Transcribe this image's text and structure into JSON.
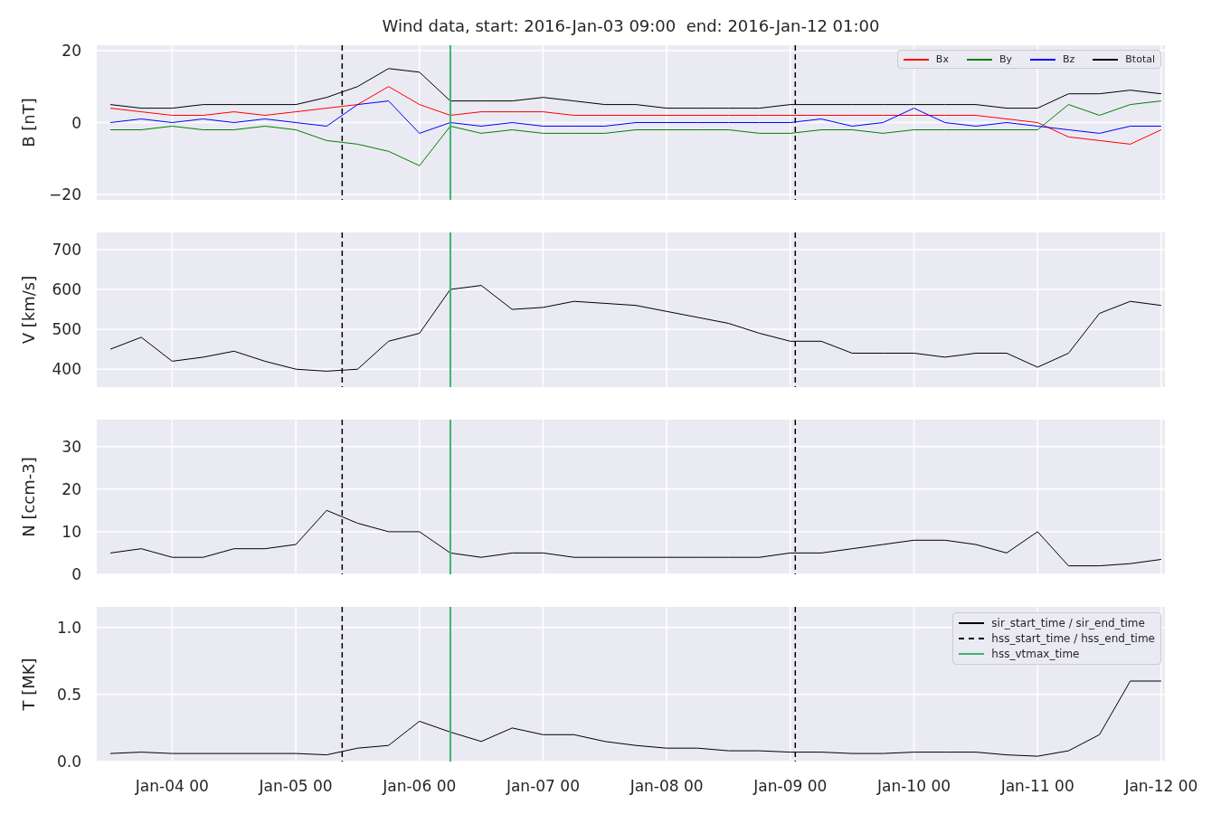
{
  "figure": {
    "title": "Wind data, start: 2016-Jan-03 09:00  end: 2016-Jan-12 01:00"
  },
  "panels": [
    {
      "chart_data": {
        "type": "line",
        "grid": true,
        "ylabel": "B [nT]",
        "ylim": [
          -21.5,
          21.5
        ],
        "yticks": [
          {
            "value": 20,
            "label": "20"
          },
          {
            "value": 0,
            "label": "0"
          },
          {
            "value": -20,
            "label": "−20"
          }
        ],
        "series": [
          {
            "name": "Bx",
            "color": "#ff0000",
            "values": [
              4,
              3,
              2,
              2,
              3,
              2,
              3,
              4,
              5,
              10,
              5,
              2,
              3,
              3,
              3,
              2,
              2,
              2,
              2,
              2,
              2,
              2,
              2,
              2,
              2,
              2,
              2,
              2,
              2,
              1,
              0,
              -4,
              -5,
              -6,
              -2
            ]
          },
          {
            "name": "By",
            "color": "#008000",
            "values": [
              -2,
              -2,
              -1,
              -2,
              -2,
              -1,
              -2,
              -5,
              -6,
              -8,
              -12,
              -1,
              -3,
              -2,
              -3,
              -3,
              -3,
              -2,
              -2,
              -2,
              -2,
              -3,
              -3,
              -2,
              -2,
              -3,
              -2,
              -2,
              -2,
              -2,
              -2,
              5,
              2,
              5,
              6
            ]
          },
          {
            "name": "Bz",
            "color": "#0000ff",
            "values": [
              0,
              1,
              0,
              1,
              0,
              1,
              0,
              -1,
              5,
              6,
              -3,
              0,
              -1,
              0,
              -1,
              -1,
              -1,
              0,
              0,
              0,
              0,
              0,
              0,
              1,
              -1,
              0,
              4,
              0,
              -1,
              0,
              -1,
              -2,
              -3,
              -1,
              -1
            ]
          },
          {
            "name": "Btotal",
            "color": "#000000",
            "values": [
              5,
              4,
              4,
              5,
              5,
              5,
              5,
              7,
              10,
              15,
              14,
              6,
              6,
              6,
              7,
              6,
              5,
              5,
              4,
              4,
              4,
              4,
              5,
              5,
              5,
              5,
              5,
              5,
              5,
              4,
              4,
              8,
              8,
              9,
              8
            ]
          }
        ]
      }
    },
    {
      "chart_data": {
        "type": "line",
        "grid": true,
        "ylabel": "V [km/s]",
        "ylim": [
          355,
          743
        ],
        "yticks": [
          {
            "value": 400,
            "label": "400"
          },
          {
            "value": 500,
            "label": "500"
          },
          {
            "value": 600,
            "label": "600"
          },
          {
            "value": 700,
            "label": "700"
          }
        ],
        "series": [
          {
            "color": "#000000",
            "values": [
              450,
              480,
              420,
              430,
              445,
              420,
              400,
              395,
              400,
              470,
              490,
              600,
              610,
              550,
              555,
              570,
              565,
              560,
              545,
              530,
              515,
              490,
              470,
              470,
              440,
              440,
              440,
              430,
              440,
              440,
              405,
              440,
              540,
              570,
              560
            ]
          }
        ]
      }
    },
    {
      "chart_data": {
        "type": "line",
        "grid": true,
        "ylabel": "N [ccm-3]",
        "ylim": [
          0,
          36.3
        ],
        "yticks": [
          {
            "value": 0,
            "label": "0"
          },
          {
            "value": 10,
            "label": "10"
          },
          {
            "value": 20,
            "label": "20"
          },
          {
            "value": 30,
            "label": "30"
          }
        ],
        "series": [
          {
            "color": "#000000",
            "values": [
              5,
              6,
              4,
              4,
              6,
              6,
              7,
              15,
              12,
              10,
              10,
              5,
              4,
              5,
              5,
              4,
              4,
              4,
              4,
              4,
              4,
              4,
              5,
              5,
              6,
              7,
              8,
              8,
              7,
              5,
              10,
              2,
              2,
              2.5,
              3.5
            ]
          }
        ]
      }
    },
    {
      "chart_data": {
        "type": "line",
        "grid": true,
        "ylabel": "T [MK]",
        "categories": [
          null,
          null,
          "Jan-04 00",
          null,
          null,
          null,
          "Jan-05 00",
          null,
          null,
          null,
          "Jan-06 00",
          null,
          null,
          null,
          "Jan-07 00",
          null,
          null,
          null,
          "Jan-08 00",
          null,
          null,
          null,
          "Jan-09 00",
          null,
          null,
          null,
          "Jan-10 00",
          null,
          null,
          null,
          "Jan-11 00",
          null,
          null,
          null,
          "Jan-12 00"
        ],
        "ylim": [
          0,
          1.153
        ],
        "yticks": [
          {
            "value": 0,
            "label": "0.0"
          },
          {
            "value": 0.5,
            "label": "0.5"
          },
          {
            "value": 1,
            "label": "1.0"
          }
        ],
        "series": [
          {
            "color": "#000000",
            "values": [
              0.06,
              0.07,
              0.06,
              0.06,
              0.06,
              0.06,
              0.06,
              0.05,
              0.1,
              0.12,
              0.3,
              0.22,
              0.15,
              0.25,
              0.2,
              0.2,
              0.15,
              0.12,
              0.1,
              0.1,
              0.08,
              0.08,
              0.07,
              0.07,
              0.06,
              0.06,
              0.07,
              0.07,
              0.07,
              0.05,
              0.04,
              0.08,
              0.2,
              0.6,
              0.6
            ]
          }
        ]
      },
      "legend": [
        {
          "label": "sir_start_time / sir_end_time",
          "color": "#000000"
        },
        {
          "label": "hss_start_time / hss_end_time",
          "color": "#000000"
        },
        {
          "label": "hss_vtmax_time",
          "color": "#3cb371"
        }
      ]
    }
  ]
}
